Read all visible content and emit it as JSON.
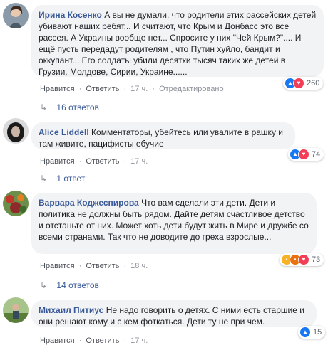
{
  "comments": [
    {
      "author": "Ирина Косенко",
      "text": "А вы не думали, что родители этих рассейских детей убивают наших ребят... И считают, что Крым и Донбасс это все рассея. А Украины вообще нет... Спросите у них \"Чей Крым?\".... И ещё пусть передадут родителям , что Путин хуйло, бандит и оккупант... Его солдаты убили десятки тысяч таких же детей в Грузии, Молдове, Сирии, Украине......",
      "like": "Нравится",
      "reply": "Ответить",
      "time": "17 ч.",
      "edited": "Отредактировано",
      "reactions_count": "260",
      "reactions": [
        "like-icon",
        "heart-icon"
      ],
      "replies": "16 ответов"
    },
    {
      "author": "Alice Liddell",
      "text": "Комментаторы, убейтесь или увалите в рашку и там живите, пацифисты ебучие",
      "like": "Нравится",
      "reply": "Ответить",
      "time": "17 ч.",
      "reactions_count": "74",
      "reactions": [
        "like-icon",
        "heart-icon"
      ],
      "replies": "1 ответ"
    },
    {
      "author": "Варвара Коджеспирова",
      "text": "Что вам сделали эти дети. Дети и политика не должны быть рядом. Дайте детям счастливое детство и отстаньте от них. Может хоть дети будут жить в Мире и дружбе со всеми странами. Так что не доводите до греха взрослые...",
      "like": "Нравится",
      "reply": "Ответить",
      "time": "18 ч.",
      "reactions_count": "73",
      "reactions": [
        "cry-icon",
        "angry-icon",
        "heart-icon"
      ],
      "replies": "14 ответов"
    },
    {
      "author": "Михаил Питиус",
      "text": "Не надо говорить о детях. С ними есть старшие и они решают кому и с кем фоткаться. Дети ту не при чем.",
      "like": "Нравится",
      "reply": "Ответить",
      "time": "17 ч.",
      "reactions_count": "15",
      "reactions": [
        "like-icon"
      ]
    }
  ],
  "colors": {
    "author": "#385898",
    "bubble": "#f2f3f5",
    "meta": "#90949c",
    "like": "#1877f2",
    "heart": "#f33e58"
  }
}
